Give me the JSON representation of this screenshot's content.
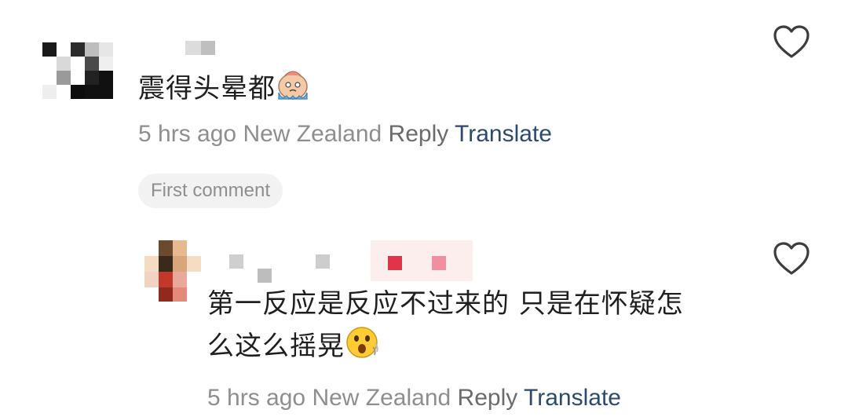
{
  "comments": [
    {
      "text": "震得头晕都",
      "emoji_icon": "crying-face-emoji",
      "meta": {
        "time": "5 hrs ago",
        "location": "New Zealand",
        "reply_label": "Reply",
        "translate_label": "Translate"
      },
      "badge": "First comment",
      "like_icon": "heart-outline-icon"
    },
    {
      "text_line1": "第一反应是反应不过来的 只是在怀疑怎",
      "text_line2": "么这么摇晃",
      "emoji_icon": "astonished-face-emoji",
      "meta": {
        "time": "5 hrs ago",
        "location": "New Zealand",
        "reply_label": "Reply",
        "translate_label": "Translate"
      },
      "like_icon": "heart-outline-icon"
    }
  ],
  "colors": {
    "text": "#1f1f1f",
    "meta_gray": "#8e8e8e",
    "translate_blue": "#2d4a6d",
    "badge_bg": "#f2f2f2"
  }
}
